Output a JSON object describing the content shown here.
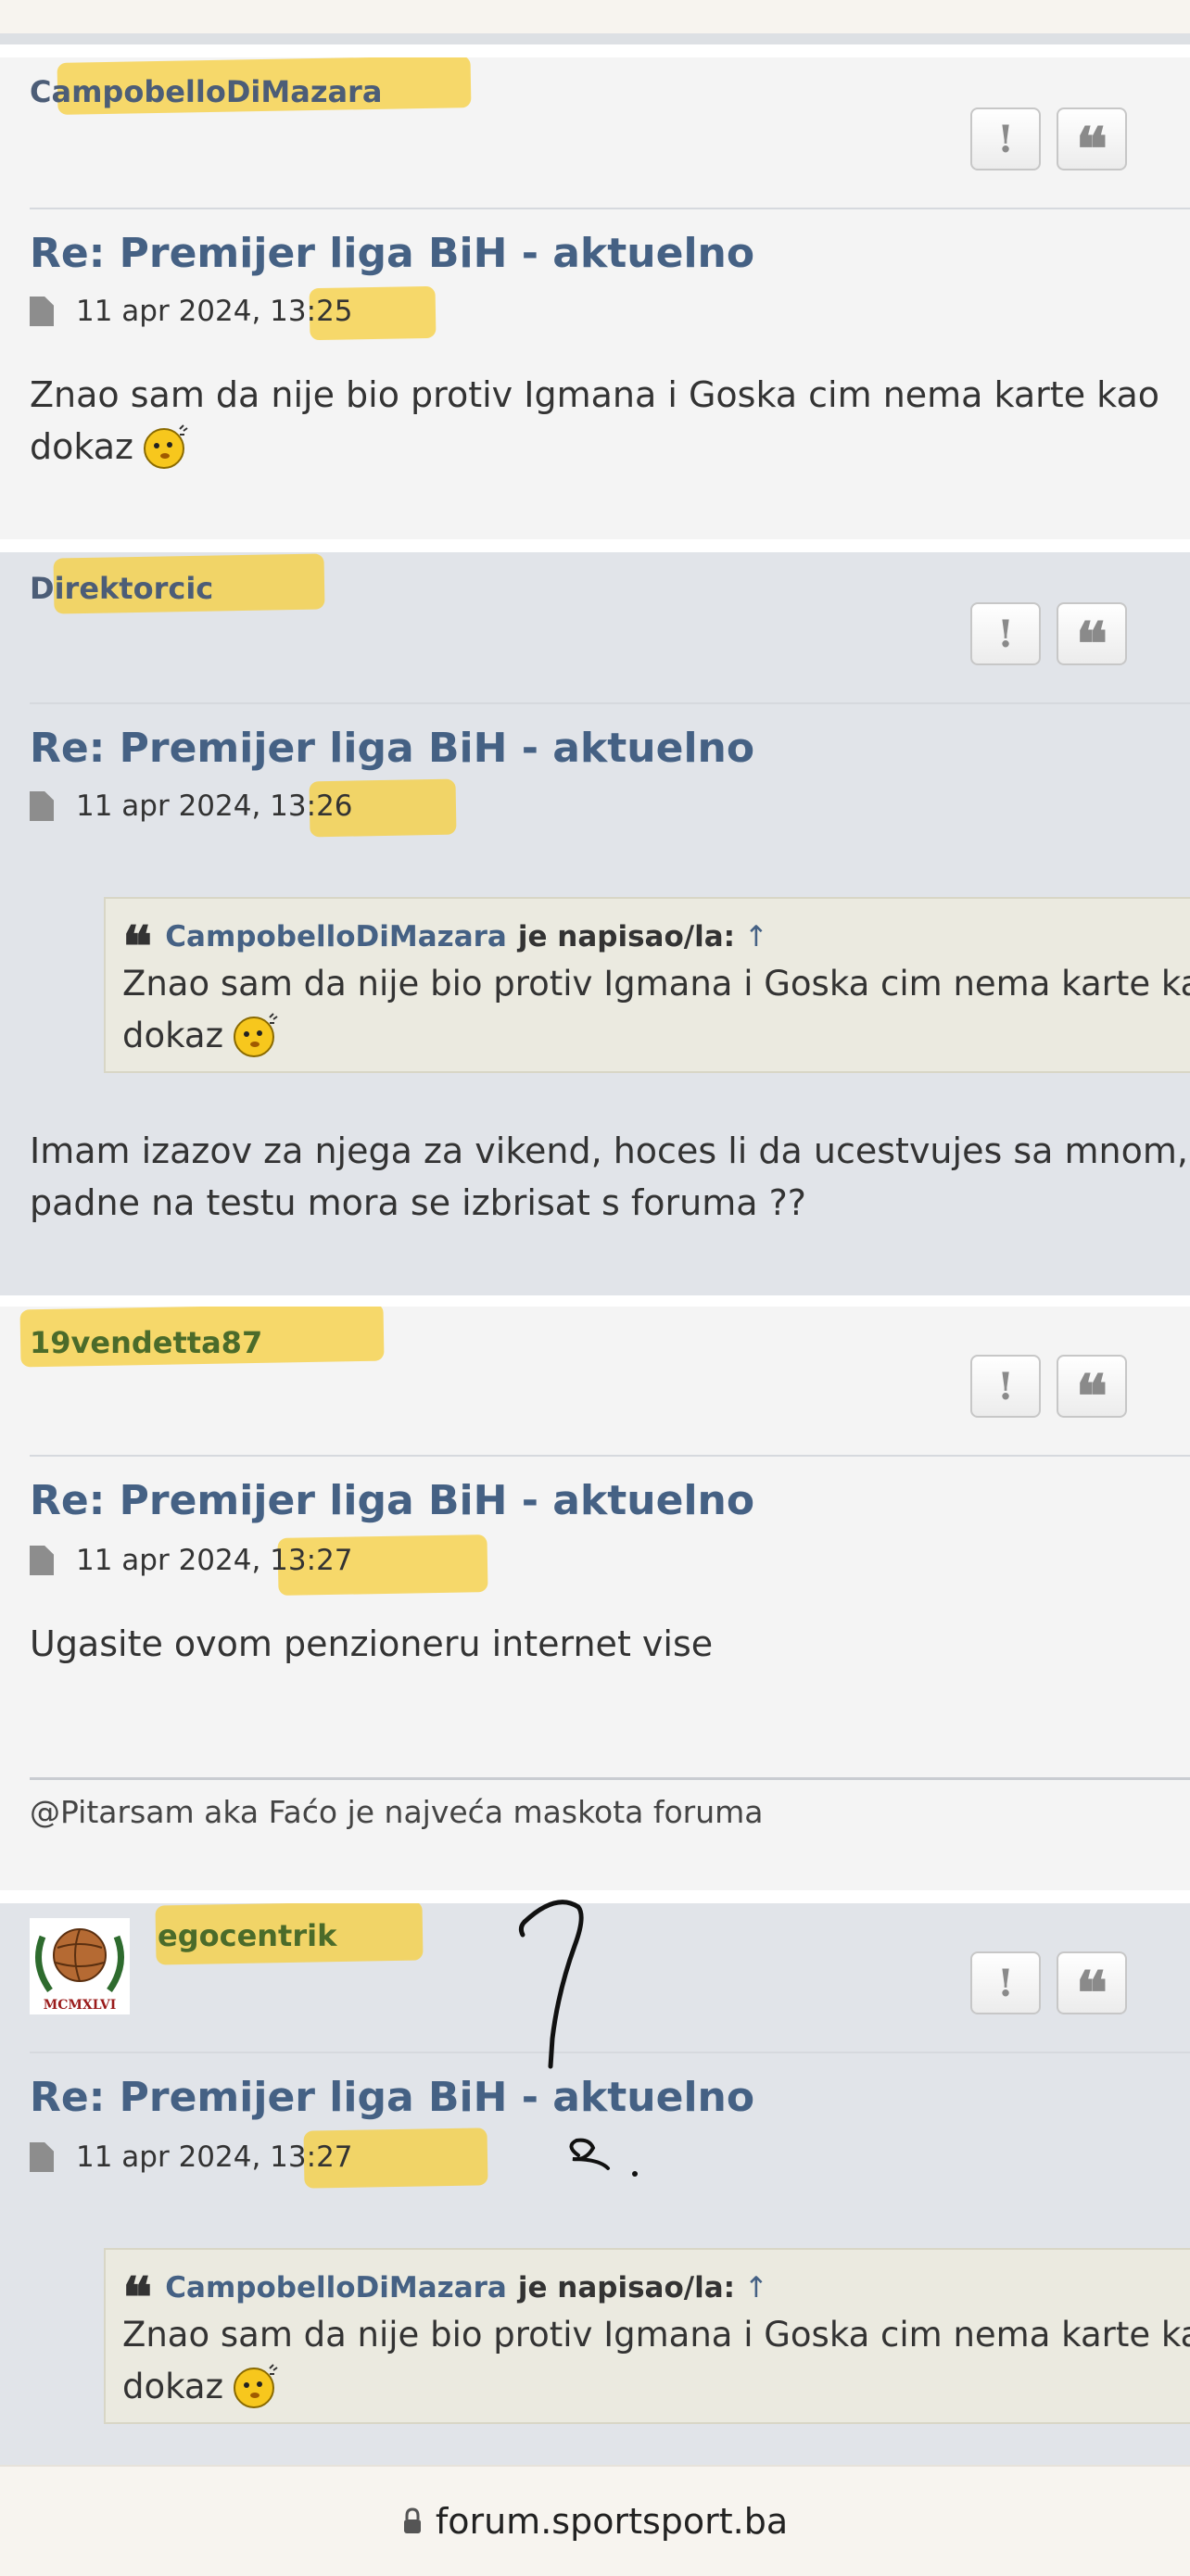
{
  "colors": {
    "highlighter": "#f6cd34",
    "link": "#456184",
    "post_bg_light": "#f4f4f4",
    "post_bg_dark": "#e1e4e9",
    "quote_bg": "#ebeae0"
  },
  "icons": {
    "report": "report-icon",
    "quote": "quote-icon",
    "post": "post-doc-icon",
    "lock": "lock-icon",
    "smiley": "smiley-icon"
  },
  "buttons": {
    "report_label": "!",
    "quote_label": "❝"
  },
  "posts": [
    {
      "author": "CampobelloDiMazara",
      "title": "Re: Premijer liga BiH - aktuelno",
      "time": "11 apr 2024, 13:25",
      "body": [
        "Znao sam da nije bio protiv Igmana i Goska cim nema karte kao",
        "dokaz"
      ]
    },
    {
      "author": "Direktorcic",
      "title": "Re: Premijer liga BiH - aktuelno",
      "time": "11 apr 2024, 13:26",
      "quote": {
        "author": "CampobelloDiMazara",
        "wrote": "je napisao/la:",
        "arrow": "↑",
        "lines": [
          "Znao sam da nije bio protiv Igmana i Goska cim nema karte kao",
          "dokaz"
        ]
      },
      "body": [
        "Imam izazov za njega za vikend, hoces li da ucestvujes sa mnom, ako",
        "padne na testu mora se izbrisat s foruma ??"
      ]
    },
    {
      "author": "19vendetta87",
      "title": "Re: Premijer liga BiH - aktuelno",
      "time": "11 apr 2024, 13:27",
      "body": [
        "Ugasite ovom penzioneru internet vise"
      ],
      "signature": "@Pitarsam aka Faćo je najveća maskota foruma"
    },
    {
      "author": "egocentrik",
      "avatar_text": "MCMXLVI",
      "title": "Re: Premijer liga BiH - aktuelno",
      "time": "11 apr 2024, 13:27",
      "quote": {
        "author": "CampobelloDiMazara",
        "wrote": "je napisao/la:",
        "arrow": "↑",
        "lines": [
          "Znao sam da nije bio protiv Igmana i Goska cim nema karte kao",
          "dokaz"
        ]
      }
    }
  ],
  "browser": {
    "url": "forum.sportsport.ba"
  }
}
